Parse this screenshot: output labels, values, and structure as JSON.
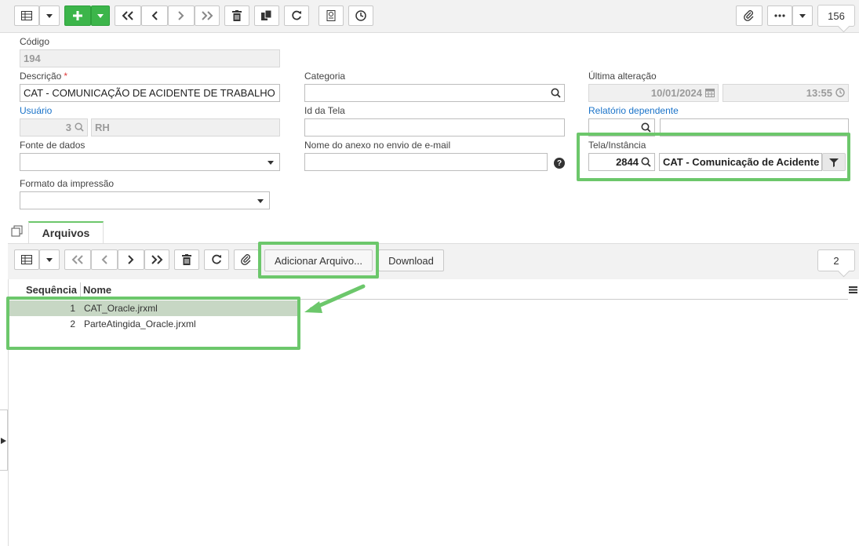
{
  "toolbar": {
    "record_counter": "156",
    "buttons": [
      "grid-view",
      "add",
      "first",
      "previous",
      "next",
      "last",
      "delete",
      "copy",
      "refresh",
      "report",
      "history",
      "attach",
      "more"
    ]
  },
  "form": {
    "codigo": {
      "label": "Código",
      "value": "194"
    },
    "descricao": {
      "label": "Descrição",
      "required": "*",
      "value": "CAT - COMUNICAÇÃO DE ACIDENTE DE TRABALHO"
    },
    "categoria": {
      "label": "Categoria",
      "value": ""
    },
    "ultima_alteracao": {
      "label": "Última alteração",
      "date": "10/01/2024",
      "time": "13:55"
    },
    "usuario": {
      "label": "Usuário",
      "id": "3",
      "name": "RH"
    },
    "id_tela": {
      "label": "Id da Tela",
      "value": ""
    },
    "relatorio_dependente": {
      "label": "Relatório dependente",
      "id": "",
      "name": ""
    },
    "fonte_dados": {
      "label": "Fonte de dados",
      "value": ""
    },
    "nome_anexo": {
      "label": "Nome do anexo no envio de e-mail",
      "value": ""
    },
    "tela_instancia": {
      "label": "Tela/Instância",
      "id": "2844",
      "name": "CAT - Comunicação de Acidente"
    },
    "formato_impressao": {
      "label": "Formato da impressão",
      "value": ""
    }
  },
  "tabs": [
    {
      "label": "Arquivos"
    }
  ],
  "subtoolbar": {
    "add_file_label": "Adicionar Arquivo...",
    "download_label": "Download",
    "record_counter": "2"
  },
  "grid": {
    "columns": [
      "Sequência",
      "Nome"
    ],
    "rows": [
      {
        "seq": "1",
        "nome": "CAT_Oracle.jrxml"
      },
      {
        "seq": "2",
        "nome": "ParteAtingida_Oracle.jrxml"
      }
    ]
  },
  "colors": {
    "highlight": "#6cc76b",
    "accent_green": "#3cb54a",
    "link": "#1a73c9",
    "selected_row": "#c7d7c4"
  }
}
